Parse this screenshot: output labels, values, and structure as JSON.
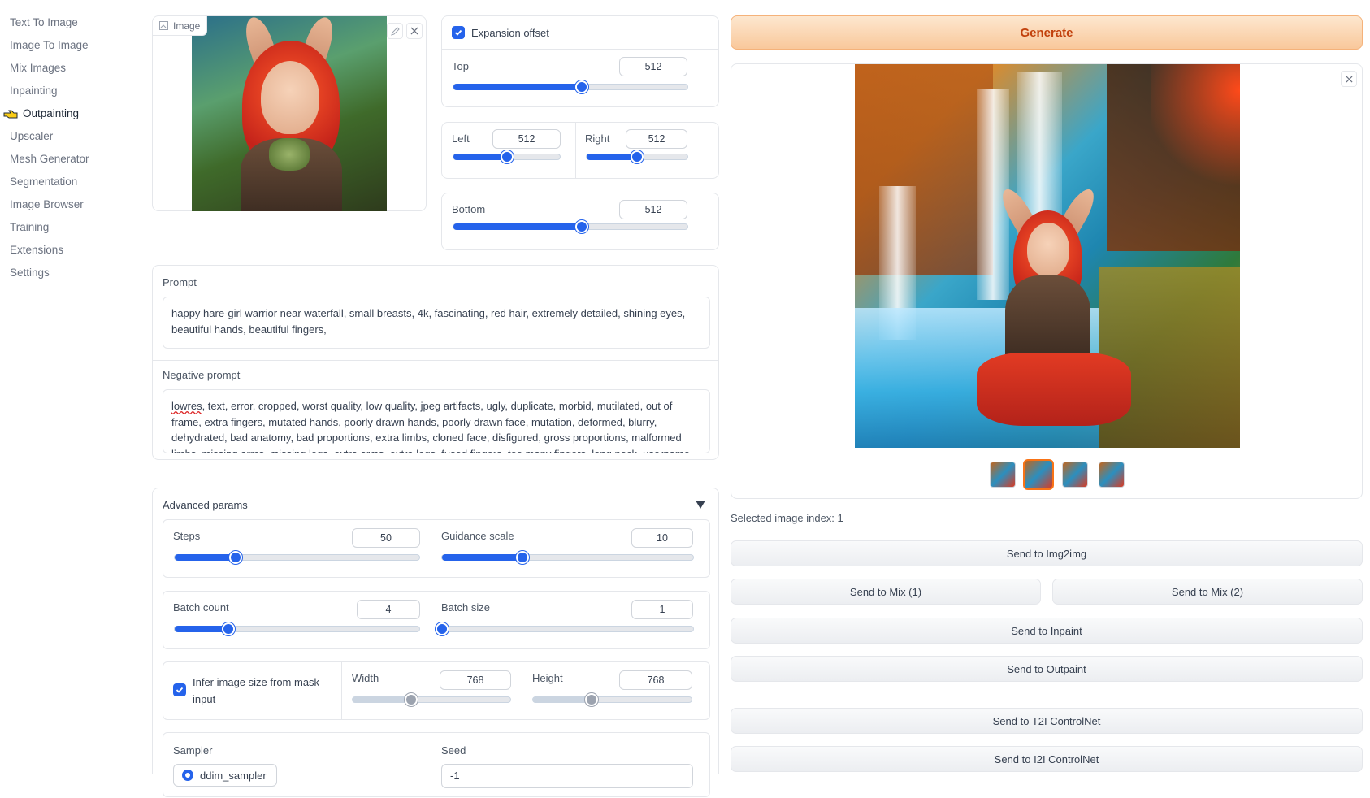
{
  "sidebar": {
    "items": [
      {
        "label": "Text To Image"
      },
      {
        "label": "Image To Image"
      },
      {
        "label": "Mix Images"
      },
      {
        "label": "Inpainting"
      },
      {
        "label": "Outpainting"
      },
      {
        "label": "Upscaler"
      },
      {
        "label": "Mesh Generator"
      },
      {
        "label": "Segmentation"
      },
      {
        "label": "Image Browser"
      },
      {
        "label": "Training"
      },
      {
        "label": "Extensions"
      },
      {
        "label": "Settings"
      }
    ],
    "active_index": 4
  },
  "input_image": {
    "tag_label": "Image",
    "edit_icon": "pencil-icon",
    "close_icon": "close-icon"
  },
  "expansion": {
    "checkbox_label": "Expansion offset",
    "checked": true,
    "top": {
      "label": "Top",
      "value": "512",
      "fraction": 0.55
    },
    "left": {
      "label": "Left",
      "value": "512",
      "fraction": 0.5
    },
    "right": {
      "label": "Right",
      "value": "512",
      "fraction": 0.5
    },
    "bottom": {
      "label": "Bottom",
      "value": "512",
      "fraction": 0.55
    }
  },
  "prompt": {
    "label": "Prompt",
    "text": "happy hare-girl warrior near waterfall, small breasts, 4k, fascinating, red hair, extremely detailed, shining eyes, beautiful hands, beautiful fingers,"
  },
  "negative_prompt": {
    "label": "Negative prompt",
    "first_word": "lowres",
    "text": ", text, error, cropped, worst quality, low quality, jpeg artifacts, ugly, duplicate, morbid, mutilated, out of frame, extra fingers, mutated hands, poorly drawn hands, poorly drawn face, mutation, deformed, blurry, dehydrated, bad anatomy, bad proportions, extra limbs, cloned face, disfigured, gross proportions, malformed limbs, missing arms, missing legs, extra arms, extra legs, fused fingers, too many fingers, long neck, username"
  },
  "advanced": {
    "title": "Advanced params",
    "steps": {
      "label": "Steps",
      "value": "50",
      "fraction": 0.25
    },
    "guidance": {
      "label": "Guidance scale",
      "value": "10",
      "fraction": 0.32
    },
    "batch_count": {
      "label": "Batch count",
      "value": "4",
      "fraction": 0.22
    },
    "batch_size": {
      "label": "Batch size",
      "value": "1",
      "fraction": 0.0
    },
    "infer": {
      "label": "Infer image size from mask input",
      "checked": true
    },
    "width": {
      "label": "Width",
      "value": "768",
      "fraction": 0.37
    },
    "height": {
      "label": "Height",
      "value": "768",
      "fraction": 0.37
    },
    "sampler": {
      "label": "Sampler",
      "value": "ddim_sampler"
    },
    "seed": {
      "label": "Seed",
      "value": "-1"
    }
  },
  "output": {
    "generate_label": "Generate",
    "close_icon": "close-icon",
    "selected_index_text": "Selected image index: 1",
    "selected_thumb": 1,
    "buttons": {
      "img2img": "Send to Img2img",
      "mix1": "Send to Mix (1)",
      "mix2": "Send to Mix (2)",
      "inpaint": "Send to Inpaint",
      "outpaint": "Send to Outpaint",
      "t2i_controlnet": "Send to T2I ControlNet",
      "i2i_controlnet": "Send to I2I ControlNet"
    }
  },
  "colors": {
    "accent": "#2563eb",
    "generate_bg": "#f9c89b",
    "generate_text": "#c2410c",
    "selected_thumb_border": "#f97316"
  }
}
